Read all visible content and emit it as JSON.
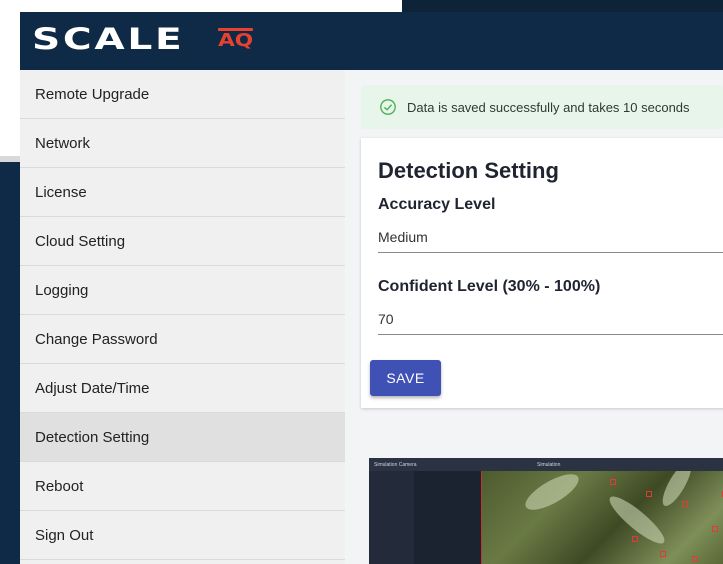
{
  "header": {
    "logo_main": "SCALE",
    "logo_sub": "AQ"
  },
  "sidebar": {
    "items": [
      {
        "label": "Remote Upgrade"
      },
      {
        "label": "Network"
      },
      {
        "label": "License"
      },
      {
        "label": "Cloud Setting"
      },
      {
        "label": "Logging"
      },
      {
        "label": "Change Password"
      },
      {
        "label": "Adjust Date/Time"
      },
      {
        "label": "Detection Setting"
      },
      {
        "label": "Reboot"
      },
      {
        "label": "Sign Out"
      }
    ],
    "active": "Detection Setting"
  },
  "alert": {
    "text": "Data is saved successfully and takes 10 seconds",
    "icon": "check-circle-icon",
    "color": "#e8f5ea"
  },
  "detection": {
    "title": "Detection Setting",
    "accuracy_label": "Accuracy Level",
    "accuracy_value": "Medium",
    "confidence_label": "Confident Level (30% - 100%)",
    "confidence_value": "70",
    "save_label": "SAVE"
  },
  "camera": {
    "title": "Simulation Camera",
    "tab": "Simulation"
  },
  "colors": {
    "header": "#0f2a47",
    "accent": "#3f51b5",
    "logo_accent": "#e8412f"
  }
}
